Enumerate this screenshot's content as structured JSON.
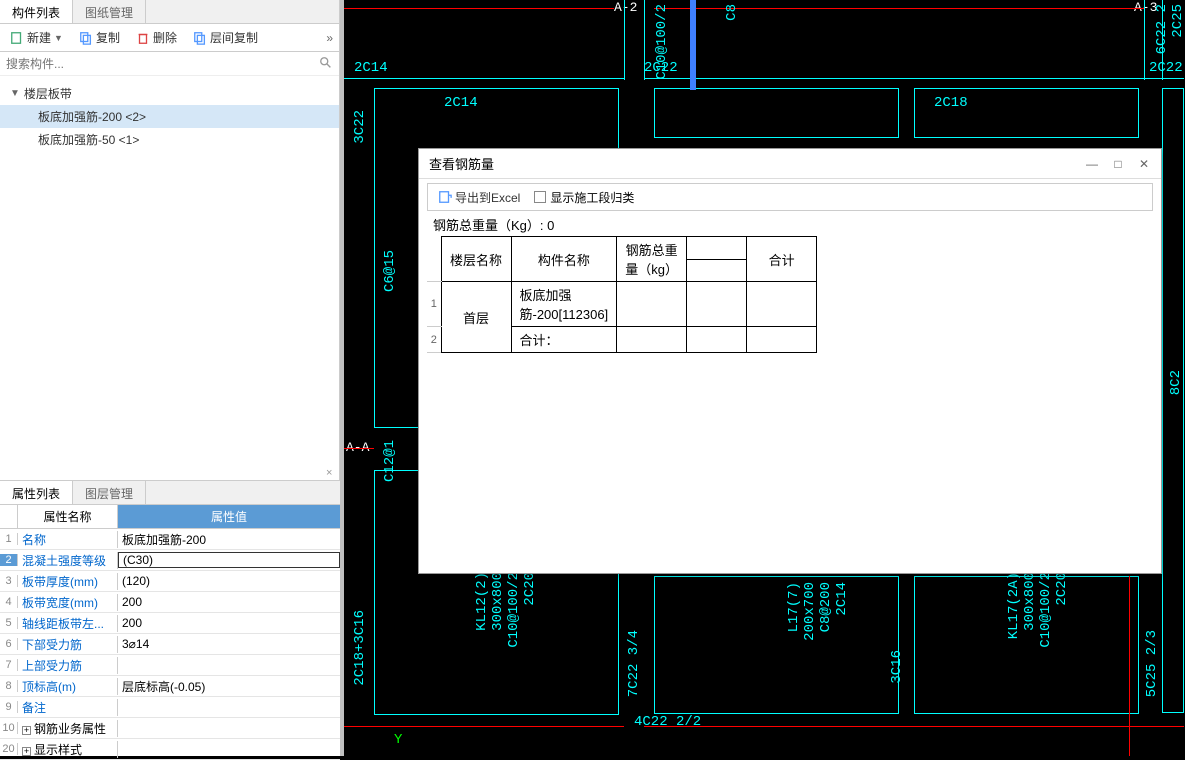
{
  "panel_tabs": {
    "components": "构件列表",
    "drawings": "图纸管理"
  },
  "toolbar": {
    "new": "新建",
    "copy": "复制",
    "delete": "删除",
    "floor_copy": "层间复制"
  },
  "search": {
    "placeholder": "搜索构件..."
  },
  "tree": {
    "root": "楼层板带",
    "item1": "板底加强筋-200 <2>",
    "item2": "板底加强筋-50 <1>"
  },
  "prop_tabs": {
    "props": "属性列表",
    "layers": "图层管理"
  },
  "prop_header": {
    "name": "属性名称",
    "value": "属性值"
  },
  "props": [
    {
      "n": "1",
      "name": "名称",
      "val": "板底加强筋-200",
      "link": true
    },
    {
      "n": "2",
      "name": "混凝土强度等级",
      "val": "(C30)",
      "link": true,
      "sel": true
    },
    {
      "n": "3",
      "name": "板带厚度(mm)",
      "val": "(120)",
      "link": true
    },
    {
      "n": "4",
      "name": "板带宽度(mm)",
      "val": "200",
      "link": true
    },
    {
      "n": "5",
      "name": "轴线距板带左...",
      "val": "200",
      "link": true
    },
    {
      "n": "6",
      "name": "下部受力筋",
      "val": "3⌀14",
      "link": true
    },
    {
      "n": "7",
      "name": "上部受力筋",
      "val": "",
      "link": true
    },
    {
      "n": "8",
      "name": "顶标高(m)",
      "val": "层底标高(-0.05)",
      "link": true
    },
    {
      "n": "9",
      "name": "备注",
      "val": "",
      "link": true
    },
    {
      "n": "10",
      "name": "钢筋业务属性",
      "val": "",
      "exp": true
    },
    {
      "n": "20",
      "name": "显示样式",
      "val": "",
      "exp": true
    }
  ],
  "dialog": {
    "title": "查看钢筋量",
    "export": "导出到Excel",
    "show_section": "显示施工段归类",
    "caption": "钢筋总重量（Kg）: 0",
    "headers": {
      "floor": "楼层名称",
      "component": "构件名称",
      "weight": "钢筋总重量（kg）",
      "total": "合计"
    },
    "rows": {
      "r1_num": "1",
      "r1_floor": "首层",
      "r1_comp": "板底加强筋-200[112306]",
      "r2_num": "2",
      "r2_label": "合计："
    }
  },
  "cad": {
    "a2": "A-2",
    "a3": "A-3",
    "aa": "A-A",
    "t_2c14_1": "2C14",
    "t_2c22_1": "2C22",
    "t_2c22_2": "2C22",
    "t_2c14_2": "2C14",
    "t_2c18": "2C18",
    "t_3c22": "3C22",
    "t_c6015": "C6@15",
    "t_c1201": "C12@1",
    "t_kl12": "KL12(2)",
    "t_300x800": "300x800",
    "t_c100100": "C10@100/2",
    "t_2c20": "2C20",
    "t_l17": "L17(7)",
    "t_200x700": "200x700",
    "t_c80200": "C8@200",
    "t_2c14_3": "2C14",
    "t_kl17": "KL17(2A)",
    "t_300x800_2": "300x800",
    "t_c100100_2": "C10@100/2",
    "t_2c20_2": "2C20",
    "t_2c18_3c16": "2C18+3C16",
    "t_7c22": "7C22 3/4",
    "t_4c22": "4C22 2/2",
    "t_3c16": "3C16",
    "t_5c25": "5C25 2/3",
    "t_c100100_3": "C10@100/2",
    "t_6c22": "6C22 2",
    "t_2c25": "2C25",
    "t_c80_top": "C8",
    "t_8c2": "8C2",
    "t_y": "Y"
  }
}
